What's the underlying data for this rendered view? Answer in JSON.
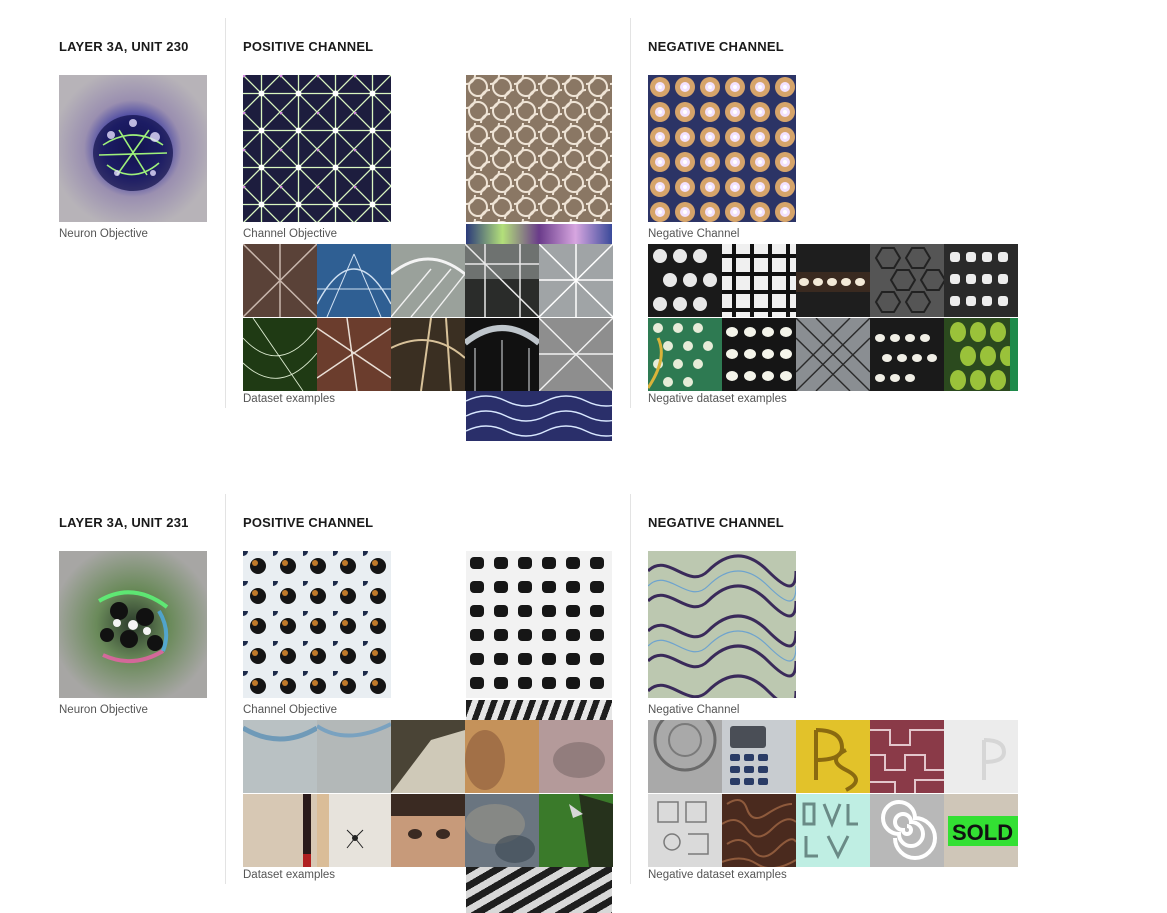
{
  "blocks": [
    {
      "layer_title": "LAYER 3A, UNIT 230",
      "neuron_caption": "Neuron Objective",
      "positive": {
        "title": "POSITIVE CHANNEL",
        "channel_caption": "Channel Objective",
        "dataset_caption": "Dataset examples"
      },
      "negative": {
        "title": "NEGATIVE CHANNEL",
        "channel_caption": "Negative Channel",
        "dataset_caption": "Negative dataset examples"
      }
    },
    {
      "layer_title": "LAYER 3A, UNIT 231",
      "neuron_caption": "Neuron Objective",
      "positive": {
        "title": "POSITIVE CHANNEL",
        "channel_caption": "Channel Objective",
        "dataset_caption": "Dataset examples"
      },
      "negative": {
        "title": "NEGATIVE CHANNEL",
        "channel_caption": "Negative Channel",
        "dataset_caption": "Negative dataset examples"
      }
    }
  ],
  "sold_sign_text": "SOLD",
  "colors": {
    "heading": "#1a1a1a",
    "caption": "#555555",
    "divider": "#e3e3e3"
  }
}
